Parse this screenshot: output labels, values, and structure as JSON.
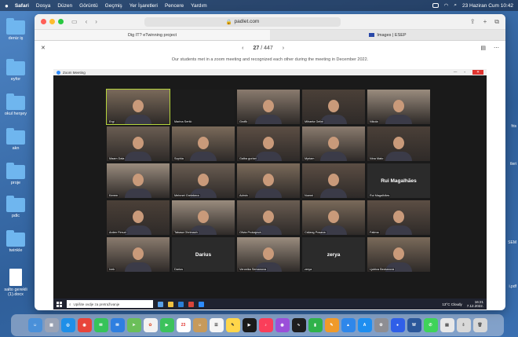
{
  "menubar": {
    "app": "Safari",
    "menus": [
      "Dosya",
      "Düzen",
      "Görüntü",
      "Geçmiş",
      "Yer İşaretleri",
      "Pencere",
      "Yardım"
    ],
    "datetime": "23 Haziran Cum 10:42"
  },
  "desktop": {
    "left_icons": [
      "deniz iş",
      "eyfor",
      "okul herşey",
      "akn",
      "proje",
      "pdlc",
      "twinkle",
      "salto gerekli (1).docx"
    ],
    "right_labels": [
      "fris",
      "tleri",
      "SEM",
      "​i.pdf"
    ]
  },
  "browser": {
    "url": "padlet.com",
    "tabs": [
      {
        "label": "Dig IT? eTwinning project"
      },
      {
        "label": "Images | ESEP"
      }
    ]
  },
  "viewer": {
    "current": "27",
    "separator": "/",
    "total": "447",
    "caption": "Our students met in a zoom meeting and recognized each other during the meeting in December 2022."
  },
  "zoom": {
    "title": "Zoom Meeting",
    "participants": [
      {
        "name": "Ergi",
        "type": "video",
        "active": true
      },
      {
        "name": "Marina Sertić",
        "type": "dark"
      },
      {
        "name": "Grofik",
        "type": "video"
      },
      {
        "name": "Mihaela Gelini",
        "type": "video"
      },
      {
        "name": "Nikola",
        "type": "video"
      },
      {
        "name": "Maam Dala",
        "type": "video"
      },
      {
        "name": "Sophia",
        "type": "video"
      },
      {
        "name": "Galba gurlari",
        "type": "video"
      },
      {
        "name": "Myriam",
        "type": "video"
      },
      {
        "name": "Nina Mato",
        "type": "video"
      },
      {
        "name": "Kerem",
        "type": "video"
      },
      {
        "name": "Mehmet Grelebera",
        "type": "video"
      },
      {
        "name": "Admin",
        "type": "video"
      },
      {
        "name": "Noemi",
        "type": "video"
      },
      {
        "name": "Rui Magalhães",
        "type": "text",
        "big": "Rui Magalhães"
      },
      {
        "name": "Arden Fimuri",
        "type": "video"
      },
      {
        "name": "Tabasa Ohrimach",
        "type": "video"
      },
      {
        "name": "Olivia Prokajová",
        "type": "video"
      },
      {
        "name": "Csilang Posana",
        "type": "video"
      },
      {
        "name": "Fatima",
        "type": "video"
      },
      {
        "name": "Ivek",
        "type": "video"
      },
      {
        "name": "Darius",
        "type": "text",
        "big": "Darius"
      },
      {
        "name": "Veronika Semanova",
        "type": "video"
      },
      {
        "name": "zerya",
        "type": "text",
        "big": "zerya"
      },
      {
        "name": "Ljubica Bezkarová",
        "type": "video"
      }
    ]
  },
  "taskbar": {
    "search_placeholder": "Upišite ovdje za pretraživanje",
    "weather": "13°C Cloudy",
    "time": "16:21",
    "date": "7.12.2022."
  },
  "dock": {
    "calendar_day": "23"
  }
}
